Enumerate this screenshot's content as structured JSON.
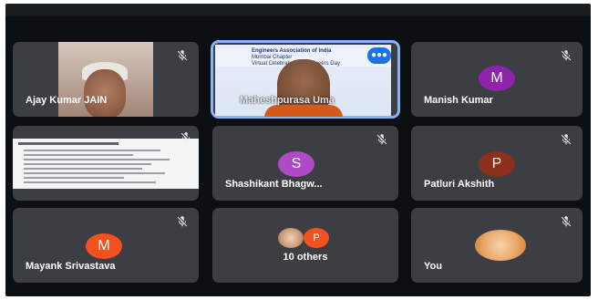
{
  "participants": [
    {
      "name": "Ajay Kumar JAIN",
      "type": "video",
      "muted": true
    },
    {
      "name": "Maheshpurasa Uma",
      "type": "screen",
      "active_speaker": true,
      "slide_title_lines": [
        "Engineers Association of India",
        "Mumbai Chapter",
        "Virtual Celebration of Engineers Day"
      ]
    },
    {
      "name": "Manish Kumar",
      "type": "avatar",
      "initial": "M",
      "color": "#8e24aa",
      "muted": true
    },
    {
      "name": "",
      "type": "document",
      "muted": true
    },
    {
      "name": "Shashikant Bhagw...",
      "type": "avatar",
      "initial": "S",
      "color": "#b04bc7",
      "muted": true
    },
    {
      "name": "Patluri Akshith",
      "type": "avatar",
      "initial": "P",
      "color": "#8c2f1c",
      "muted": true
    },
    {
      "name": "Mayank Srivastava",
      "type": "avatar",
      "initial": "M",
      "color": "#f4511e",
      "muted": true
    },
    {
      "name": "10 others",
      "type": "group",
      "initial": "P",
      "color": "#f4511e"
    },
    {
      "name": "You",
      "type": "self",
      "muted": true
    }
  ],
  "icons": {
    "muted": "mic-off-icon",
    "speaking": "speaking-icon"
  }
}
